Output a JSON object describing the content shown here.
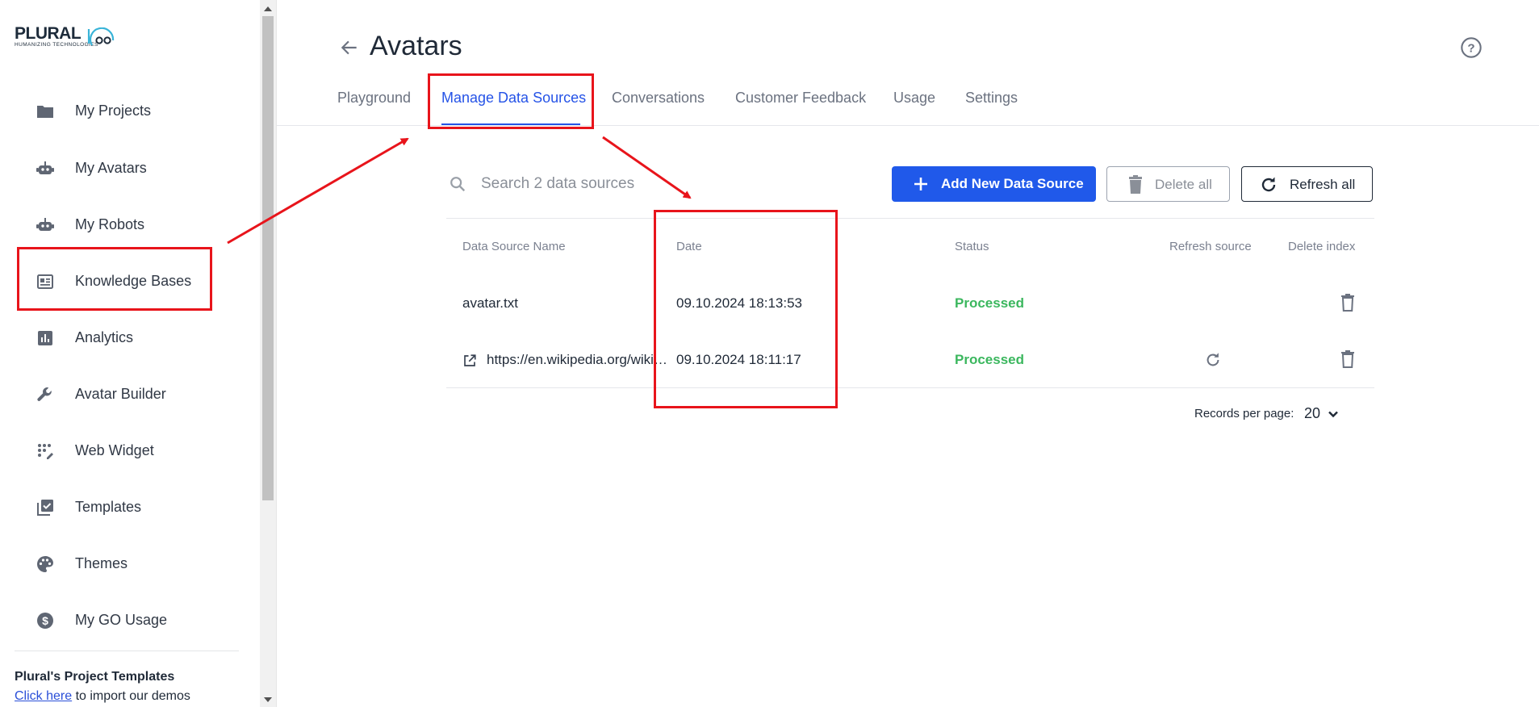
{
  "logo": {
    "word": "PLURAL",
    "tagline": "HUMANIZING TECHNOLOGIES"
  },
  "sidebar": {
    "items": [
      {
        "label": "My Projects",
        "icon": "folder-icon"
      },
      {
        "label": "My Avatars",
        "icon": "robot-icon"
      },
      {
        "label": "My Robots",
        "icon": "robot-icon"
      },
      {
        "label": "Knowledge Bases",
        "icon": "knowledge-base-icon"
      },
      {
        "label": "Analytics",
        "icon": "analytics-icon"
      },
      {
        "label": "Avatar Builder",
        "icon": "wrench-icon"
      },
      {
        "label": "Web Widget",
        "icon": "widget-icon"
      },
      {
        "label": "Templates",
        "icon": "templates-icon"
      },
      {
        "label": "Themes",
        "icon": "palette-icon"
      },
      {
        "label": "My GO Usage",
        "icon": "dollar-icon"
      }
    ],
    "templates_title": "Plural's Project Templates",
    "templates_link": "Click here",
    "templates_suffix": " to import our demos"
  },
  "header": {
    "title": "Avatars",
    "tabs": [
      {
        "label": "Playground"
      },
      {
        "label": "Manage Data Sources",
        "active": true
      },
      {
        "label": "Conversations"
      },
      {
        "label": "Customer Feedback"
      },
      {
        "label": "Usage"
      },
      {
        "label": "Settings"
      }
    ]
  },
  "toolbar": {
    "search_placeholder": "Search 2 data sources",
    "add_label": "Add New Data Source",
    "delete_all_label": "Delete all",
    "refresh_all_label": "Refresh all"
  },
  "table": {
    "columns": [
      "Data Source Name",
      "Date",
      "Status",
      "Refresh source",
      "Delete index"
    ],
    "rows": [
      {
        "name": "avatar.txt",
        "is_link": false,
        "date": "09.10.2024 18:13:53",
        "status": "Processed",
        "refreshable": false
      },
      {
        "name": "https://en.wikipedia.org/wiki/Avatar",
        "is_link": true,
        "date": "09.10.2024 18:11:17",
        "status": "Processed",
        "refreshable": true
      }
    ],
    "records_per_page_label": "Records per page:",
    "records_per_page": "20"
  },
  "colors": {
    "accent": "#2553e7",
    "primary_button": "#2059ea",
    "status_processed": "#3bb75e",
    "annotation": "#e8141b"
  }
}
